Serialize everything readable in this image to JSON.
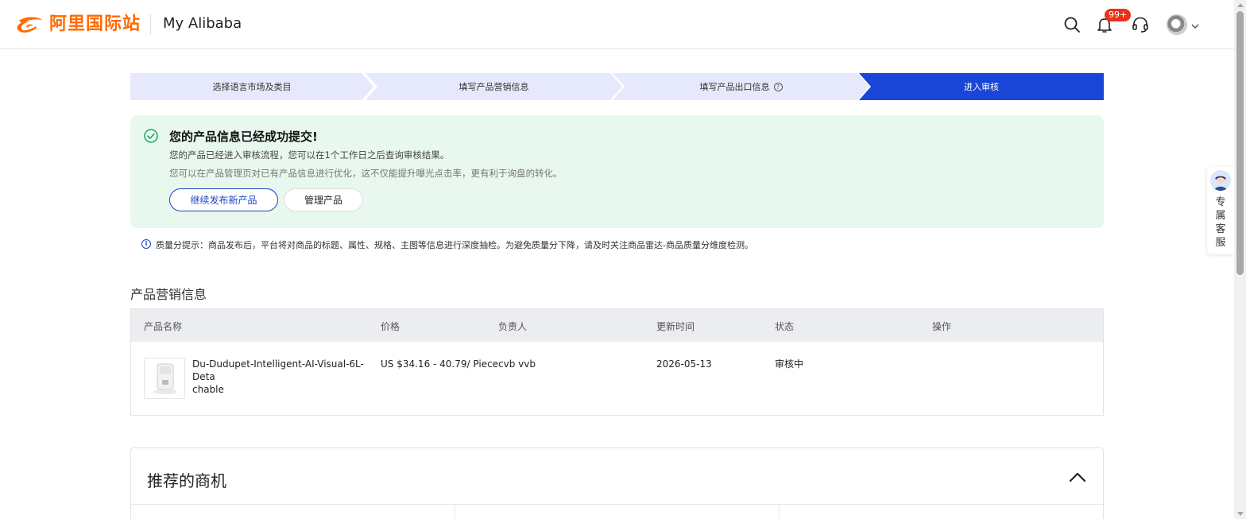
{
  "header": {
    "logo_text": "阿里国际站",
    "title": "My Alibaba",
    "notification_badge": "99+",
    "icons": [
      "search-icon",
      "bell-icon",
      "headset-icon",
      "avatar",
      "chevron-down-icon"
    ]
  },
  "stepper": {
    "steps": [
      {
        "label": "选择语言市场及类目",
        "active": false
      },
      {
        "label": "填写产品营销信息",
        "active": false
      },
      {
        "label": "填写产品出口信息",
        "active": false,
        "help": "?"
      },
      {
        "label": "进入审核",
        "active": true
      }
    ],
    "colors": {
      "inactive": "#e6e9fb",
      "active": "#1a46d8"
    }
  },
  "success": {
    "title": "您的产品信息已经成功提交!",
    "line1": "您的产品已经进入审核流程，您可以在1个工作日之后查询审核结果。",
    "line2": "您可以在产品管理页对已有产品信息进行优化，这不仅能提升曝光点击率，更有利于询盘的转化。",
    "primary_button": "继续发布新产品",
    "secondary_button": "管理产品"
  },
  "tip": {
    "icon": "i",
    "text": "质量分提示：商品发布后，平台将对商品的标题、属性、规格、主图等信息进行深度抽检。为避免质量分下降，请及时关注商品雷达-商品质量分维度检测。"
  },
  "section": {
    "title": "产品营销信息",
    "columns": [
      "产品名称",
      "价格",
      "负责人",
      "更新时间",
      "状态",
      "操作"
    ],
    "rows": [
      {
        "name_line1": "Du-Dudupet-Intelligent-AI-Visual-6L-Deta",
        "name_line2": "chable",
        "price": "US $34.16 - 40.79/ Piece",
        "owner": "cvb vvb",
        "updated": "2026-05-13",
        "status": "审核中",
        "action": ""
      }
    ]
  },
  "recommend": {
    "title": "推荐的商机"
  },
  "side_service": {
    "text": "专属客服"
  },
  "colors": {
    "brand": "#ff6a00",
    "primary": "#1a46c8",
    "success_bg": "#e8f8ef",
    "success_icon": "#1aa35c",
    "badge": "#e8321c"
  }
}
